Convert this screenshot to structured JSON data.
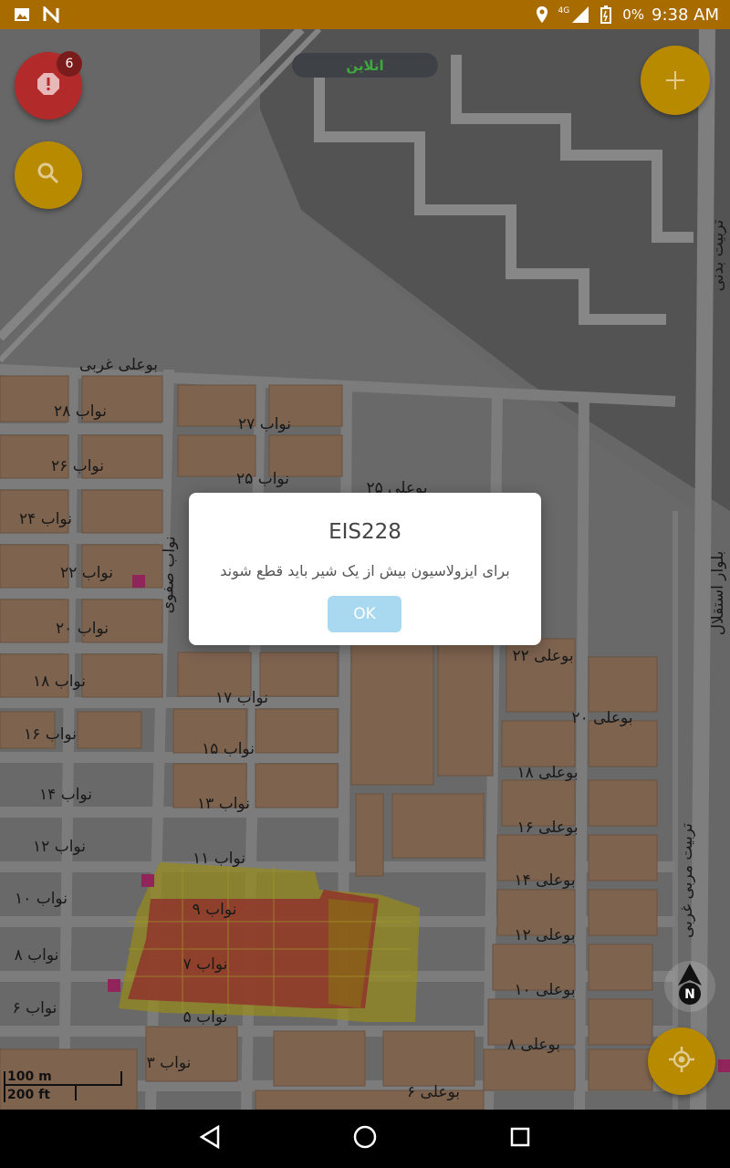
{
  "status_bar": {
    "icons_left": [
      "image-icon",
      "n-app-icon"
    ],
    "icons_right": [
      "location-icon",
      "4g-signal-icon",
      "battery-icon"
    ],
    "network": "4G",
    "battery": "0%",
    "time": "9:38 AM"
  },
  "map": {
    "status_pill": "انلاین",
    "alert_count": "6",
    "scale": {
      "metric": "100 m",
      "imperial": "200 ft"
    },
    "street_labels": [
      "بوعلی غربی",
      "نواب ۲۸",
      "نواب ۲۷",
      "نواب ۲۶",
      "نواب ۲۵",
      "نواب ۲۴",
      "نواب ۲۲",
      "نواب ۲۰",
      "نواب ۱۸",
      "نواب ۱۷",
      "نواب ۱۶",
      "نواب ۱۵",
      "نواب ۱۴",
      "نواب ۱۳",
      "نواب ۱۲",
      "نواب ۱۱",
      "نواب ۱۰",
      "نواب ۹",
      "نواب ۸",
      "نواب ۷",
      "نواب ۶",
      "نواب ۵",
      "نواب ۳",
      "نواب صفوی",
      "بوعلی ۲۲",
      "بوعلی ۲۰",
      "بوعلی ۱۸",
      "بوعلی ۱۶",
      "بوعلی ۱۴",
      "بوعلی ۱۲",
      "بوعلی ۱۰",
      "بوعلی ۸",
      "بوعلی ۶",
      "بوعلی ۲۵",
      "بلوار استقلال",
      "تربیت بدنی",
      "تربیت مربی غربی"
    ]
  },
  "dialog": {
    "title": "EIS228",
    "message": "برای ایزولاسیون بیش از یک شیر باید قطع شوند",
    "ok_label": "OK"
  },
  "colors": {
    "status_bar": "#a86b00",
    "fab_yellow": "#b88a00",
    "fab_red": "#b22a2a",
    "building": "#a8856a",
    "highlight_red": "#c0403a",
    "highlight_yellow": "#c8b828"
  }
}
